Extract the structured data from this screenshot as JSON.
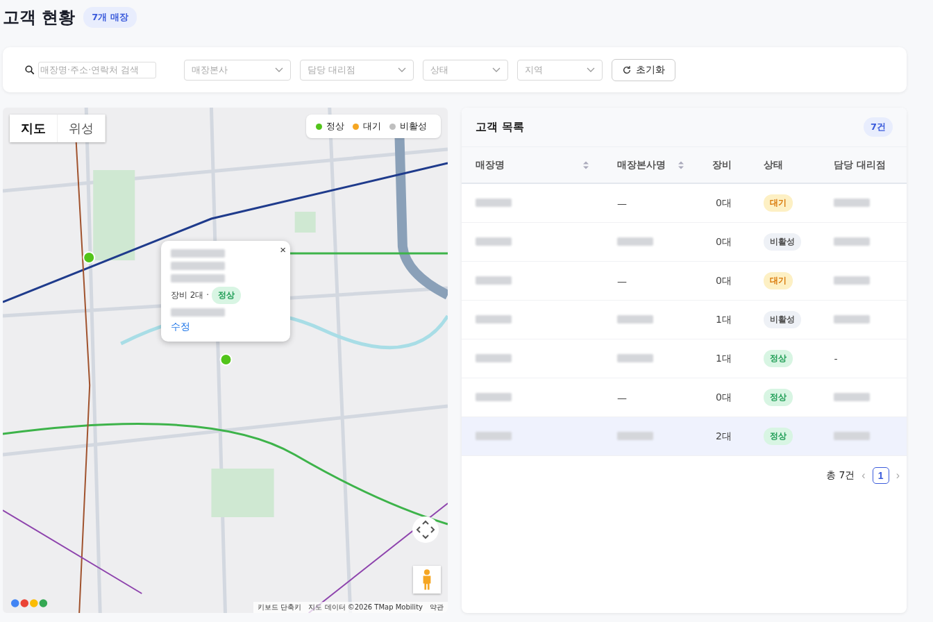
{
  "header": {
    "title": "고객 현황",
    "count_badge": "7개 매장"
  },
  "filters": {
    "search": {
      "placeholder": "매장명·주소·연락처 검색"
    },
    "dropdowns": [
      {
        "placeholder": "매장본사"
      },
      {
        "placeholder": "담당 대리점"
      },
      {
        "placeholder": "상태"
      },
      {
        "placeholder": "지역"
      }
    ],
    "reset_button": "초기화"
  },
  "map": {
    "kind": "picture",
    "view_tabs": [
      {
        "label": "지도",
        "selected": true
      },
      {
        "label": "위성",
        "selected": false
      }
    ],
    "legend": [
      {
        "label": "정상",
        "color": "#52c41a"
      },
      {
        "label": "대기",
        "color": "#f5a623"
      },
      {
        "label": "비활성",
        "color": "#bfbfbf"
      }
    ],
    "popup": {
      "lines": [
        {
          "kind": "redacted"
        },
        {
          "kind": "redacted"
        },
        {
          "kind": "redacted"
        }
      ],
      "equipment": "장비 2대 ·",
      "status": {
        "kind": "normal",
        "label": "정상"
      },
      "footer": {
        "kind": "redacted"
      },
      "edit_link": "수정",
      "close": "×"
    },
    "attribution": [
      "키보드 단축키",
      "지도 데이터 ©2026 TMap Mobility",
      "약관"
    ]
  },
  "customer_list": {
    "title": "고객 목록",
    "count_badge": "7건",
    "columns": [
      {
        "label": "매장명",
        "sortable": true
      },
      {
        "label": "매장본사명",
        "sortable": true
      },
      {
        "label": "장비",
        "sortable": false
      },
      {
        "label": "상태",
        "sortable": false
      },
      {
        "label": "담당 대리점",
        "sortable": false
      }
    ],
    "rows": [
      {
        "selected": false,
        "store": {
          "kind": "redacted"
        },
        "hq": {
          "kind": "text",
          "text": "—"
        },
        "equipment": "0대",
        "status": {
          "kind": "waiting",
          "label": "대기"
        },
        "agency": {
          "kind": "redacted"
        }
      },
      {
        "selected": false,
        "store": {
          "kind": "redacted"
        },
        "hq": {
          "kind": "redacted"
        },
        "equipment": "0대",
        "status": {
          "kind": "inactive",
          "label": "비활성"
        },
        "agency": {
          "kind": "redacted"
        }
      },
      {
        "selected": false,
        "store": {
          "kind": "redacted"
        },
        "hq": {
          "kind": "text",
          "text": "—"
        },
        "equipment": "0대",
        "status": {
          "kind": "waiting",
          "label": "대기"
        },
        "agency": {
          "kind": "redacted"
        }
      },
      {
        "selected": false,
        "store": {
          "kind": "redacted"
        },
        "hq": {
          "kind": "redacted"
        },
        "equipment": "1대",
        "status": {
          "kind": "inactive",
          "label": "비활성"
        },
        "agency": {
          "kind": "redacted"
        }
      },
      {
        "selected": false,
        "store": {
          "kind": "redacted"
        },
        "hq": {
          "kind": "redacted"
        },
        "equipment": "1대",
        "status": {
          "kind": "normal",
          "label": "정상"
        },
        "agency": {
          "kind": "text",
          "text": "-"
        }
      },
      {
        "selected": false,
        "store": {
          "kind": "redacted"
        },
        "hq": {
          "kind": "text",
          "text": "—"
        },
        "equipment": "0대",
        "status": {
          "kind": "normal",
          "label": "정상"
        },
        "agency": {
          "kind": "redacted"
        }
      },
      {
        "selected": true,
        "store": {
          "kind": "redacted"
        },
        "hq": {
          "kind": "redacted"
        },
        "equipment": "2대",
        "status": {
          "kind": "normal",
          "label": "정상"
        },
        "agency": {
          "kind": "redacted"
        }
      }
    ],
    "pagination": {
      "total": "총 7건",
      "prev": "‹",
      "pages": [
        {
          "label": "1",
          "selected": true
        }
      ],
      "next": "›"
    }
  }
}
